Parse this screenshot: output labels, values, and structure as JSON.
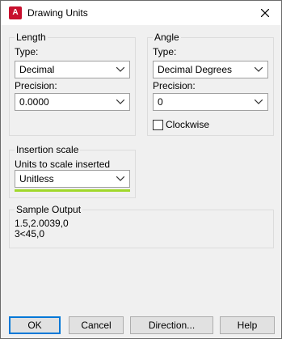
{
  "window": {
    "title": "Drawing Units",
    "app_icon_letter": "A"
  },
  "length": {
    "legend": "Length",
    "type_label": "Type:",
    "type_value": "Decimal",
    "precision_label": "Precision:",
    "precision_value": "0.0000"
  },
  "angle": {
    "legend": "Angle",
    "type_label": "Type:",
    "type_value": "Decimal Degrees",
    "precision_label": "Precision:",
    "precision_value": "0",
    "clockwise_label": "Clockwise",
    "clockwise_checked": false
  },
  "insertion": {
    "legend": "Insertion scale",
    "units_label": "Units to scale inserted content:",
    "units_value": "Unitless"
  },
  "sample": {
    "legend": "Sample Output",
    "line1": "1.5,2.0039,0",
    "line2": "3<45,0"
  },
  "buttons": {
    "ok": "OK",
    "cancel": "Cancel",
    "direction": "Direction...",
    "help": "Help"
  },
  "colors": {
    "accent": "#0078d7",
    "highlight": "#a0d82a",
    "app_icon": "#c8102e"
  }
}
